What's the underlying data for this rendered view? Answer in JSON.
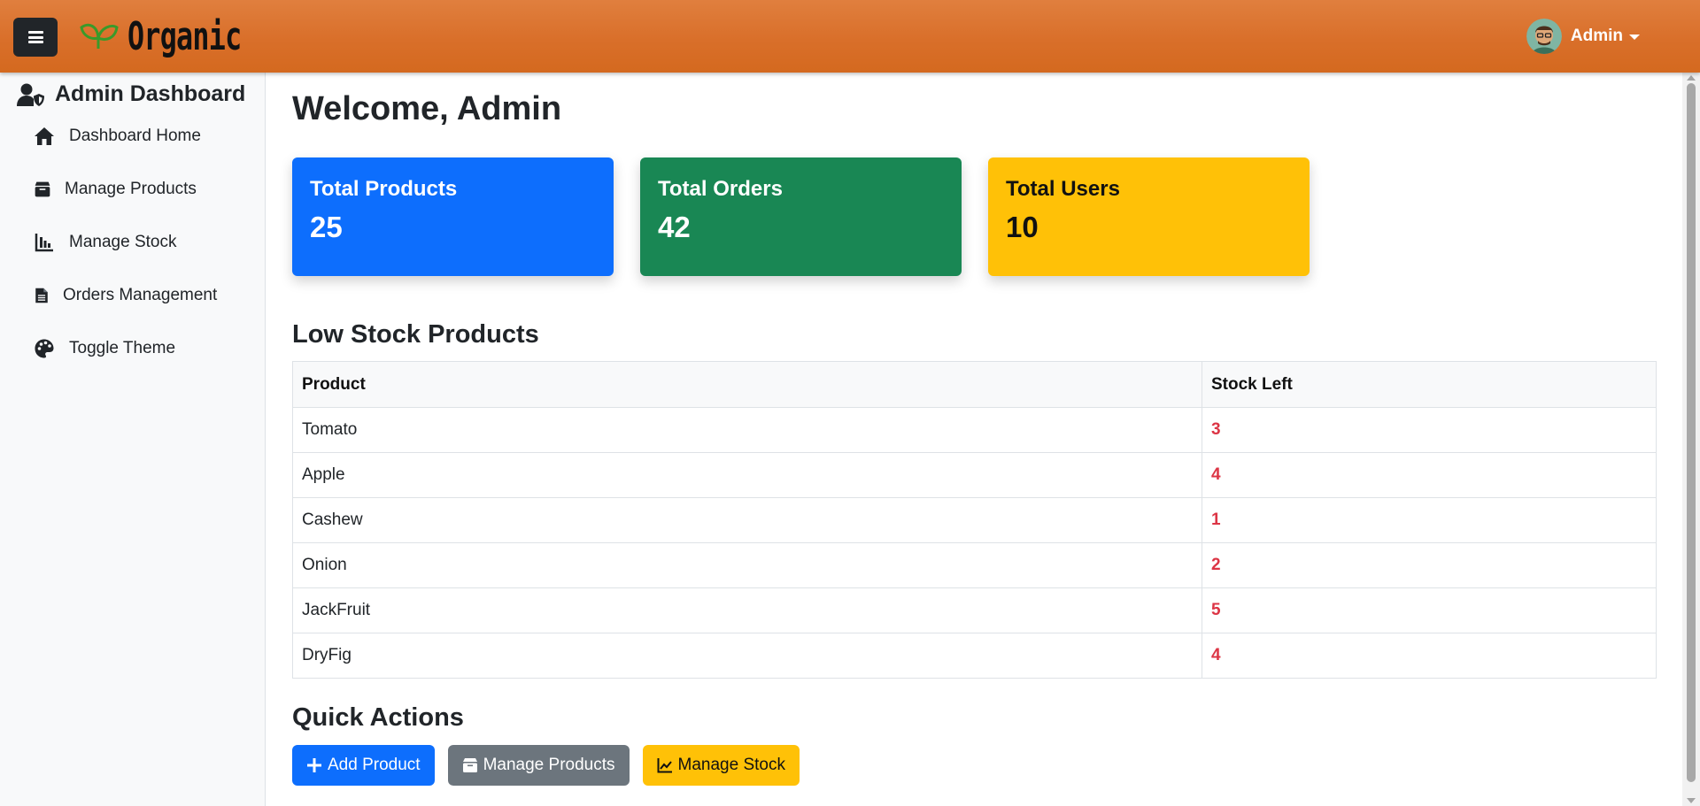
{
  "navbar": {
    "brand": "Organic",
    "user_name": "Admin",
    "colors": {
      "bar": "#d96f2a"
    }
  },
  "sidebar": {
    "title": "Admin Dashboard",
    "items": [
      {
        "label": "Dashboard Home",
        "icon": "home-icon"
      },
      {
        "label": "Manage Products",
        "icon": "box-icon"
      },
      {
        "label": "Manage Stock",
        "icon": "bar-chart-icon"
      },
      {
        "label": "Orders Management",
        "icon": "document-icon"
      },
      {
        "label": "Toggle Theme",
        "icon": "palette-icon"
      }
    ]
  },
  "main": {
    "welcome": "Welcome, Admin",
    "stats": [
      {
        "label": "Total Products",
        "value": "25",
        "color": "#0d6efd"
      },
      {
        "label": "Total Orders",
        "value": "42",
        "color": "#198754"
      },
      {
        "label": "Total Users",
        "value": "10",
        "color": "#ffc107"
      }
    ],
    "low_stock": {
      "title": "Low Stock Products",
      "columns": [
        "Product",
        "Stock Left"
      ],
      "rows": [
        {
          "product": "Tomato",
          "stock": "3"
        },
        {
          "product": "Apple",
          "stock": "4"
        },
        {
          "product": "Cashew",
          "stock": "1"
        },
        {
          "product": "Onion",
          "stock": "2"
        },
        {
          "product": "JackFruit",
          "stock": "5"
        },
        {
          "product": "DryFig",
          "stock": "4"
        }
      ]
    },
    "quick_actions": {
      "title": "Quick Actions",
      "buttons": [
        {
          "label": "Add Product",
          "icon": "plus-icon"
        },
        {
          "label": "Manage Products",
          "icon": "box-icon"
        },
        {
          "label": "Manage Stock",
          "icon": "line-chart-icon"
        }
      ]
    }
  }
}
